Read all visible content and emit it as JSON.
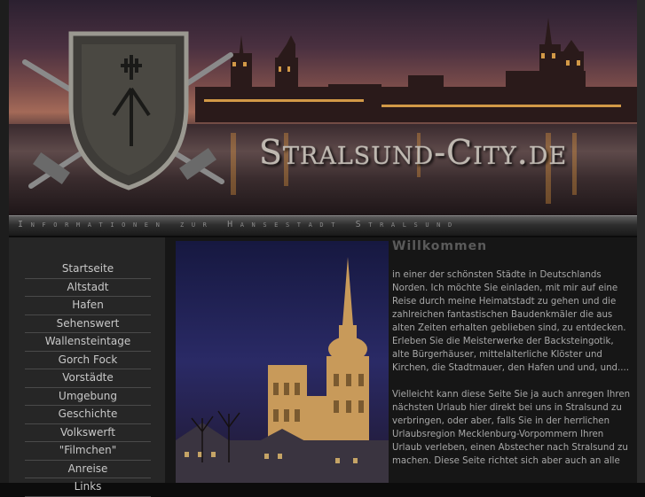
{
  "header": {
    "logo_text": "Stralsund-City.de",
    "subtitle": "Informationen zur Hansestadt Stralsund"
  },
  "navigation": {
    "items": [
      {
        "label": "Startseite"
      },
      {
        "label": "Altstadt"
      },
      {
        "label": "Hafen"
      },
      {
        "label": "Sehenswert"
      },
      {
        "label": "Wallensteintage"
      },
      {
        "label": "Gorch Fock"
      },
      {
        "label": "Vorstädte"
      },
      {
        "label": "Umgebung"
      },
      {
        "label": "Geschichte"
      },
      {
        "label": "Volkswerft"
      },
      {
        "label": "\"Filmchen\""
      },
      {
        "label": "Anreise"
      },
      {
        "label": "Links"
      }
    ]
  },
  "main": {
    "title": "Willkommen",
    "paragraphs": [
      "in einer der schönsten Städte in Deutschlands Norden. Ich möchte Sie einladen, mit mir auf eine Reise durch meine Heimatstadt zu gehen und die zahlreichen fantastischen Baudenkmäler die aus alten Zeiten erhalten geblieben sind, zu entdecken. Erleben Sie die Meisterwerke der Backsteingotik, alte Bürgerhäuser, mittelalterliche Klöster und Kirchen, die Stadtmauer, den Hafen und und, und....",
      "Vielleicht kann diese Seite Sie ja auch anregen Ihren nächsten Urlaub hier direkt bei uns in Stralsund zu verbringen, oder aber, falls Sie in der herrlichen Urlaubsregion Mecklenburg-Vorpommern Ihren Urlaub verleben, einen Abstecher nach Stralsund zu machen. Diese Seite richtet sich aber auch an alle"
    ]
  },
  "colors": {
    "background": "#0c0c0c",
    "sidebar": "#262626",
    "nav_text": "#c8c8c8",
    "body_text": "#a8a8a8",
    "title_text": "#5a5a5a"
  },
  "icons": {
    "crest": "shield-with-crossed-swords-icon"
  }
}
